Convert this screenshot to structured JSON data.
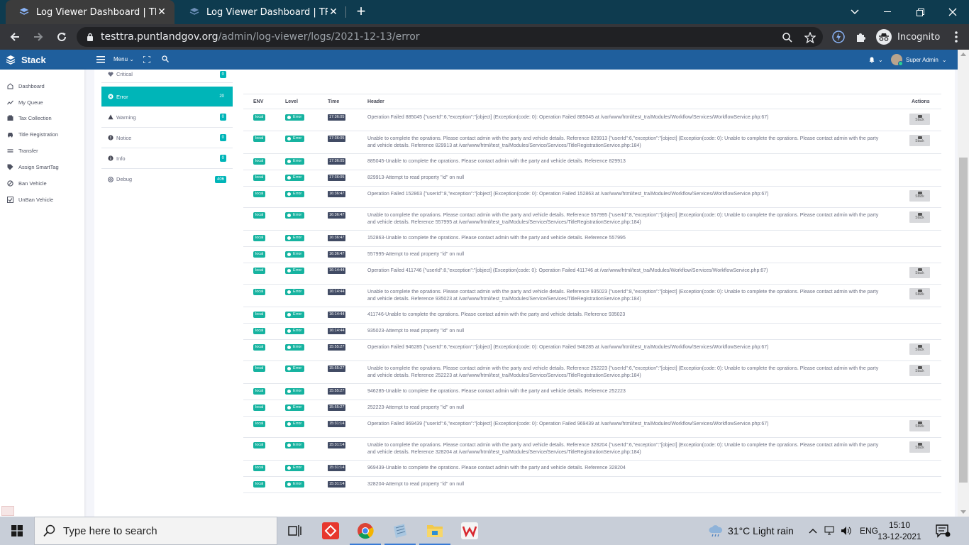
{
  "browser": {
    "tabs": [
      {
        "title": "Log Viewer Dashboard | TRA App",
        "close": "✕"
      },
      {
        "title": "Log Viewer Dashboard | TRA App",
        "close": "✕"
      }
    ],
    "new_tab": "+",
    "url_host": "testtra.puntlandgov.org",
    "url_path": "/admin/log-viewer/logs/2021-12-13/error",
    "profile_label": "Incognito"
  },
  "app": {
    "brand": "Stack",
    "menu_label": "Menu",
    "user_name": "Super Admin",
    "accent": "#1f5f9d",
    "teal": "#00b5b8"
  },
  "sidebar": {
    "items": [
      {
        "label": "Dashboard",
        "icon": "home-icon"
      },
      {
        "label": "My Queue",
        "icon": "trend-icon"
      },
      {
        "label": "Tax Collection",
        "icon": "register-icon"
      },
      {
        "label": "Title Registration",
        "icon": "car-icon"
      },
      {
        "label": "Transfer",
        "icon": "transfer-icon"
      },
      {
        "label": "Assign SmartTag",
        "icon": "tag-icon"
      },
      {
        "label": "Ban Vehicle",
        "icon": "ban-icon"
      },
      {
        "label": "UnBan Vehicle",
        "icon": "check-icon"
      }
    ]
  },
  "levels": [
    {
      "label": "Critical",
      "count": "0"
    },
    {
      "label": "Error",
      "count": "20"
    },
    {
      "label": "Warning",
      "count": "0"
    },
    {
      "label": "Notice",
      "count": "0"
    },
    {
      "label": "Info",
      "count": "0"
    },
    {
      "label": "Debug",
      "count": "406"
    }
  ],
  "table": {
    "headers": {
      "env": "ENV",
      "level": "Level",
      "time": "Time",
      "header": "Header",
      "actions": "Actions"
    },
    "stack_label": "Stack",
    "rows": [
      {
        "env": "local",
        "level": "Error",
        "time": "17:36:05",
        "header": "Operation Failed 885045 {\"userId\":6,\"exception\":\"[object] (Exception(code: 0): Operation Failed 885045 at /var/www/html/test_tra/Modules/Workflow/Services/WorkflowService.php:67)",
        "stack": true
      },
      {
        "env": "local",
        "level": "Error",
        "time": "17:36:05",
        "header": "Unable to complete the oprations. Please contact admin with the party and vehicle details. Reference 829913 {\"userId\":6,\"exception\":\"[object] (Exception(code: 0): Unable to complete the oprations. Please contact admin with the party and vehicle details. Reference 829913 at /var/www/html/test_tra/Modules/Service/Services/TitleRegistrationService.php:184)",
        "stack": true
      },
      {
        "env": "local",
        "level": "Error",
        "time": "17:36:05",
        "header": "885045-Unable to complete the oprations. Please contact admin with the party and vehicle details. Reference 829913",
        "stack": false
      },
      {
        "env": "local",
        "level": "Error",
        "time": "17:36:05",
        "header": "829913-Attempt to read property \"id\" on null",
        "stack": false
      },
      {
        "env": "local",
        "level": "Error",
        "time": "16:36:47",
        "header": "Operation Failed 152863 {\"userId\":8,\"exception\":\"[object] (Exception(code: 0): Operation Failed 152863 at /var/www/html/test_tra/Modules/Workflow/Services/WorkflowService.php:67)",
        "stack": true
      },
      {
        "env": "local",
        "level": "Error",
        "time": "16:36:47",
        "header": "Unable to complete the oprations. Please contact admin with the party and vehicle details. Reference 557995 {\"userId\":8,\"exception\":\"[object] (Exception(code: 0): Unable to complete the oprations. Please contact admin with the party and vehicle details. Reference 557995 at /var/www/html/test_tra/Modules/Service/Services/TitleRegistrationService.php:184)",
        "stack": true
      },
      {
        "env": "local",
        "level": "Error",
        "time": "16:36:47",
        "header": "152863-Unable to complete the oprations. Please contact admin with the party and vehicle details. Reference 557995",
        "stack": false
      },
      {
        "env": "local",
        "level": "Error",
        "time": "16:36:47",
        "header": "557995-Attempt to read property \"id\" on null",
        "stack": false
      },
      {
        "env": "local",
        "level": "Error",
        "time": "16:14:44",
        "header": "Operation Failed 411746 {\"userId\":8,\"exception\":\"[object] (Exception(code: 0): Operation Failed 411746 at /var/www/html/test_tra/Modules/Workflow/Services/WorkflowService.php:67)",
        "stack": true
      },
      {
        "env": "local",
        "level": "Error",
        "time": "16:14:44",
        "header": "Unable to complete the oprations. Please contact admin with the party and vehicle details. Reference 935023 {\"userId\":8,\"exception\":\"[object] (Exception(code: 0): Unable to complete the oprations. Please contact admin with the party and vehicle details. Reference 935023 at /var/www/html/test_tra/Modules/Service/Services/TitleRegistrationService.php:184)",
        "stack": true
      },
      {
        "env": "local",
        "level": "Error",
        "time": "16:14:44",
        "header": "411746-Unable to complete the oprations. Please contact admin with the party and vehicle details. Reference 935023",
        "stack": false
      },
      {
        "env": "local",
        "level": "Error",
        "time": "16:14:44",
        "header": "935023-Attempt to read property \"id\" on null",
        "stack": false
      },
      {
        "env": "local",
        "level": "Error",
        "time": "15:55:27",
        "header": "Operation Failed 946285 {\"userId\":6,\"exception\":\"[object] (Exception(code: 0): Operation Failed 946285 at /var/www/html/test_tra/Modules/Workflow/Services/WorkflowService.php:67)",
        "stack": true
      },
      {
        "env": "local",
        "level": "Error",
        "time": "15:55:27",
        "header": "Unable to complete the oprations. Please contact admin with the party and vehicle details. Reference 252223 {\"userId\":6,\"exception\":\"[object] (Exception(code: 0): Unable to complete the oprations. Please contact admin with the party and vehicle details. Reference 252223 at /var/www/html/test_tra/Modules/Service/Services/TitleRegistrationService.php:184)",
        "stack": true
      },
      {
        "env": "local",
        "level": "Error",
        "time": "15:55:27",
        "header": "946285-Unable to complete the oprations. Please contact admin with the party and vehicle details. Reference 252223",
        "stack": false
      },
      {
        "env": "local",
        "level": "Error",
        "time": "15:55:27",
        "header": "252223-Attempt to read property \"id\" on null",
        "stack": false
      },
      {
        "env": "local",
        "level": "Error",
        "time": "15:31:14",
        "header": "Operation Failed 969439 {\"userId\":6,\"exception\":\"[object] (Exception(code: 0): Operation Failed 969439 at /var/www/html/test_tra/Modules/Workflow/Services/WorkflowService.php:67)",
        "stack": true
      },
      {
        "env": "local",
        "level": "Error",
        "time": "15:31:14",
        "header": "Unable to complete the oprations. Please contact admin with the party and vehicle details. Reference 328204 {\"userId\":6,\"exception\":\"[object] (Exception(code: 0): Unable to complete the oprations. Please contact admin with the party and vehicle details. Reference 328204 at /var/www/html/test_tra/Modules/Service/Services/TitleRegistrationService.php:184)",
        "stack": true
      },
      {
        "env": "local",
        "level": "Error",
        "time": "15:31:14",
        "header": "969439-Unable to complete the oprations. Please contact admin with the party and vehicle details. Reference 328204",
        "stack": false
      },
      {
        "env": "local",
        "level": "Error",
        "time": "15:31:14",
        "header": "328204-Attempt to read property \"id\" on null",
        "stack": false
      }
    ]
  },
  "taskbar": {
    "search_placeholder": "Type here to search",
    "weather": "31°C  Light rain",
    "lang": "ENG",
    "time": "15:10",
    "date": "13-12-2021"
  }
}
